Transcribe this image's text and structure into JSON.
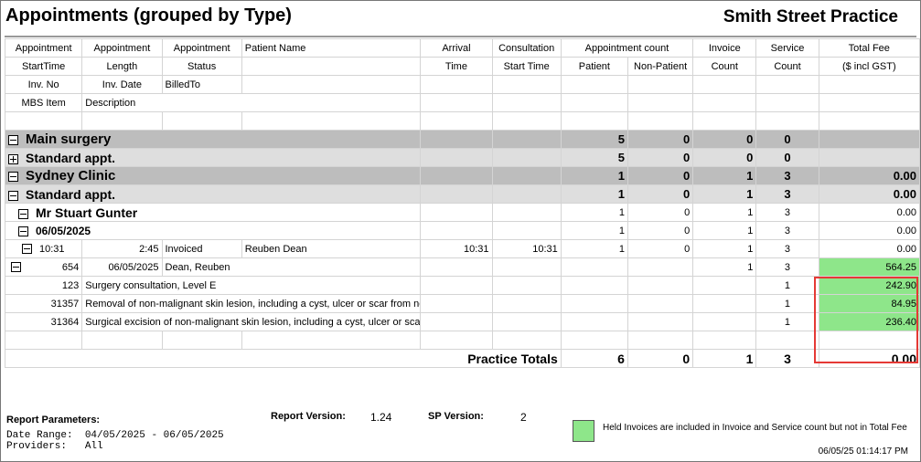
{
  "report": {
    "title": "Appointments (grouped by Type)",
    "practice": "Smith Street Practice"
  },
  "header": {
    "row1": [
      "Appointment",
      "Appointment",
      "Appointment",
      "Patient Name",
      "Arrival",
      "Consultation",
      "Appointment count",
      "Invoice",
      "Service",
      "Total Fee"
    ],
    "row2": [
      "StartTime",
      "Length",
      "Status",
      "Time",
      "Start Time",
      "Patient",
      "Non-Patient",
      "Count",
      "Count",
      "($ incl GST)"
    ],
    "row3": [
      "Inv. No",
      "Inv. Date",
      "BilledTo"
    ],
    "row4": [
      "MBS Item",
      "Description"
    ]
  },
  "groups": {
    "main_surgery": {
      "name": "Main surgery",
      "patient": "5",
      "non_patient": "0",
      "invoice": "0",
      "service": "0",
      "fee": ""
    },
    "main_standard": {
      "name": "Standard appt.",
      "patient": "5",
      "non_patient": "0",
      "invoice": "0",
      "service": "0",
      "fee": ""
    },
    "sydney_clinic": {
      "name": "Sydney Clinic",
      "patient": "1",
      "non_patient": "0",
      "invoice": "1",
      "service": "3",
      "fee": "0.00"
    },
    "sydney_standard": {
      "name": "Standard appt.",
      "patient": "1",
      "non_patient": "0",
      "invoice": "1",
      "service": "3",
      "fee": "0.00"
    },
    "patient": {
      "name": "Mr Stuart Gunter",
      "patient": "1",
      "non_patient": "0",
      "invoice": "1",
      "service": "3",
      "fee": "0.00"
    },
    "date": {
      "name": "06/05/2025",
      "patient": "1",
      "non_patient": "0",
      "invoice": "1",
      "service": "3",
      "fee": "0.00"
    }
  },
  "appointment": {
    "start": "10:31",
    "length": "2:45",
    "status": "Invoiced",
    "patient_name": "Reuben Dean",
    "arrival": "10:31",
    "consult_start": "10:31",
    "patient": "1",
    "non_patient": "0",
    "invoice": "1",
    "service": "3",
    "fee": "0.00"
  },
  "invoice": {
    "no": "654",
    "date": "06/05/2025",
    "billed_to": "Dean, Reuben",
    "invoice": "1",
    "service": "3",
    "fee": "564.25"
  },
  "items": [
    {
      "mbs": "123",
      "desc": "Surgery consultation, Level E",
      "service": "1",
      "fee": "242.90"
    },
    {
      "mbs": "31357",
      "desc": "Removal of non-malignant skin lesion, including a cyst, ulcer or scar from nose,",
      "service": "1",
      "fee": "84.95"
    },
    {
      "mbs": "31364",
      "desc": "Surgical excision of non-malignant skin lesion, including a cyst, ulcer or scar fro",
      "service": "1",
      "fee": "236.40"
    }
  ],
  "totals": {
    "label": "Practice Totals",
    "patient": "6",
    "non_patient": "0",
    "invoice": "1",
    "service": "3",
    "fee": "0.00"
  },
  "footer": {
    "params_label": "Report Parameters:",
    "date_range_label": "Date Range:",
    "date_range": "04/05/2025 - 06/05/2025",
    "providers_label": "Providers:",
    "providers": "All",
    "report_version_label": "Report Version:",
    "report_version": "1.24",
    "sp_version_label": "SP Version:",
    "sp_version": "2",
    "legend": "Held Invoices are included in Invoice and Service count but not in Total Fee",
    "timestamp": "06/05/25 01:14:17 PM"
  },
  "colors": {
    "held": "#8ee68a",
    "highlight": "#e53935",
    "group1": "#bdbdbd",
    "group2": "#dedede"
  }
}
